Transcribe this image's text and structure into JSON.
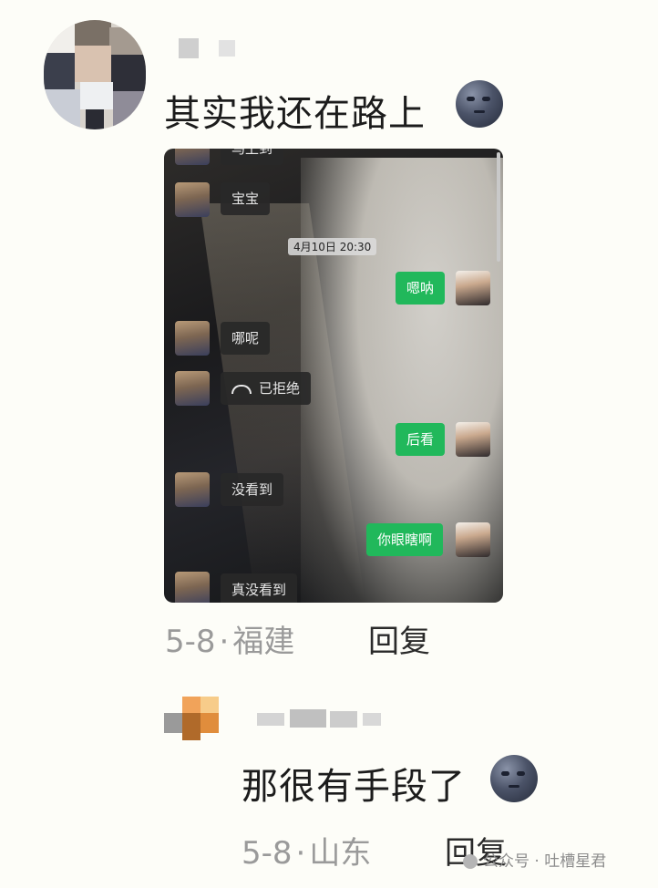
{
  "comment1": {
    "text": "其实我还在路上",
    "emoji": "new-moon-face-emoji",
    "date": "5-8",
    "separator": "·",
    "location": "福建",
    "reply_label": "回复"
  },
  "screenshot": {
    "timestamp": "4月10日 20:30",
    "messages": [
      {
        "side": "left",
        "text": "马上到"
      },
      {
        "side": "left",
        "text": "宝宝"
      },
      {
        "side": "right",
        "text": "嗯呐"
      },
      {
        "side": "left",
        "text": "哪呢"
      },
      {
        "side": "left",
        "text": "已拒绝",
        "icon": "call-declined-icon"
      },
      {
        "side": "right",
        "text": "后看"
      },
      {
        "side": "left",
        "text": "没看到"
      },
      {
        "side": "right",
        "text": "你眼瞎啊"
      },
      {
        "side": "left",
        "text": "真没看到"
      }
    ]
  },
  "comment2": {
    "text": "那很有手段了",
    "emoji": "new-moon-face-emoji",
    "date": "5-8",
    "separator": "·",
    "location": "山东",
    "reply_label": "回复"
  },
  "watermark": {
    "text": "公众号 · 吐槽星君"
  },
  "colors": {
    "background": "#fdfdf8",
    "wechat_green": "#21b85b",
    "meta_gray": "#9a9a9a"
  }
}
